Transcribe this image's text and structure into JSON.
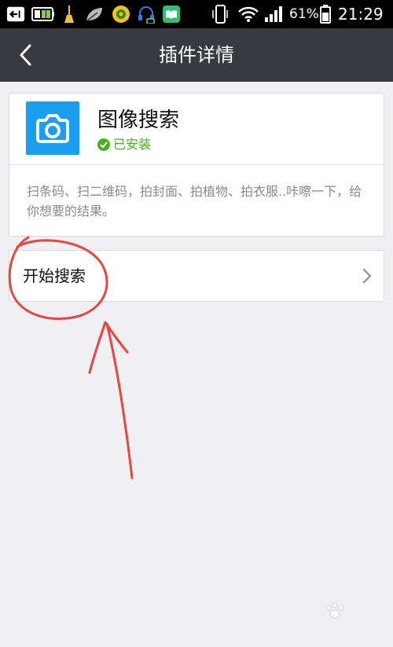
{
  "status_bar": {
    "battery_percent": "61%",
    "time": "21:29",
    "icons": [
      "back-arrow-icon",
      "battery-saver-icon",
      "broom-icon",
      "leaf-icon",
      "app-icon",
      "headset-icon",
      "book-icon",
      "vibrate-icon",
      "wifi-icon",
      "signal-icon",
      "battery-icon"
    ],
    "background": "#000000"
  },
  "header": {
    "title": "插件详情",
    "back_icon": "chevron-left-icon",
    "background": "#393a3f"
  },
  "plugin": {
    "icon": "camera-icon",
    "icon_color": "#1a9ff0",
    "name": "图像搜索",
    "status": "已安装",
    "status_icon": "check-circle-icon",
    "status_color": "#4caf22",
    "description": "扫条码、扫二维码，拍封面、拍植物、拍衣服..咔嚓一下，给你想要的结果。"
  },
  "actions": {
    "start_search_label": "开始搜索",
    "chevron_icon": "chevron-right-icon"
  },
  "annotation": {
    "color": "#e8473f"
  }
}
